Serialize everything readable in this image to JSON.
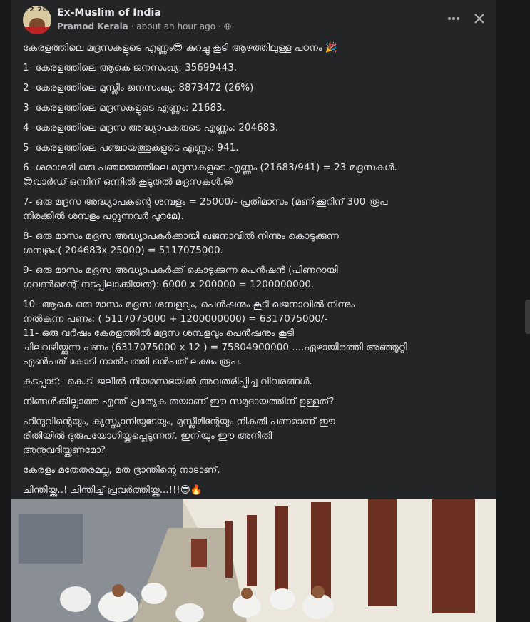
{
  "post": {
    "group_name": "Ex-Muslim of India",
    "author": "Pramod Kerala",
    "time": "about an hour ago",
    "separator": "·",
    "avatar_text": "22 20",
    "paragraphs": [
      "കേരളത്തിലെ മദ്രസകളുടെ എണ്ണം😎 കുറച്ചു കൂടി ആഴത്തിലുള്ള പഠനം 🎉",
      "1- കേരളത്തിലെ ആകെ ജനസംഖ്യ: 35699443.",
      "2- കേരളത്തിലെ മുസ്ലീം ജനസംഖ്യ: 8873472 (26%)",
      "3- കേരളത്തിലെ മദ്രസകളുടെ എണ്ണം: 21683.",
      "4- കേരളത്തിലെ മദ്രസ അദ്ധ്യാപകരുടെ എണ്ണം: 204683.",
      "5- കേരളത്തിലെ പഞ്ചായത്തുകളുടെ എണ്ണം: 941.",
      "6- ശരാശരി ഒരു പഞ്ചായത്തിലെ മദ്രസകളുടെ എണ്ണം (21683/941) = 23 മദ്രസകൾ.\n😎വാർഡ് ഒന്നിന് ഒന്നിൽ കൂടുതൽ മദ്രസകൾ.😀",
      "7- ഒരു മദ്രസ അദ്ധ്യാപകന്റെ ശമ്പളം = 25000/- പ്രതിമാസം (മണിക്കൂറിന് 300 രൂപ\nനിരക്കിൽ ശമ്പളം പറ്റുന്നവർ പുറമേ).",
      "8- ഒരു മാസം മദ്രസ അദ്ധ്യാപകർക്കായി ഖജനാവിൽ നിന്നും കൊടുക്കുന്ന\nശമ്പളം:( 204683x 25000) = 5117075000.",
      "9- ഒരു മാസം മദ്രസ അദ്ധ്യാപകർക്ക് കൊടുക്കുന്ന പെൻഷൻ (പിണറായി\nഗവൺമെന്റ് നടപ്പിലാക്കിയത്): 6000 x 200000 = 1200000000.",
      "10- ആകെ ഒരു മാസം മദ്രസ ശമ്പളവും, പെൻഷനും കൂടി ഖജനാവിൽ നിന്നും\nനൽകുന്ന പണം: ( 5117075000 + 1200000000) = 6317075000/-",
      "11- ഒരു വർഷം കേരളത്തിൽ മദ്രസ ശമ്പളവും പെൻഷനും കൂടി\nചിലവഴിയ്ക്കുന്ന പണം (6317075000 x 12 ) = 75804900000 ....ഏഴായിരത്തി അഞ്ഞൂറ്റി\nഎൺപത് കോടി നാൽപത്തി ഒൻപത് ലക്ഷം രൂപ.",
      "കടപ്പാട്:- കെ.ടി ജലീൽ നിയമസഭയിൽ അവതരിപ്പിച്ച വിവരങ്ങൾ.",
      "നിങ്ങൾക്കില്ലാത്ത എന്ത് പ്രത്യേക തയാണ് ഈ സമുദായത്തിന് ഉള്ളത്?",
      "ഹിന്ദുവിന്റെയും, ക്യസ്ത്യാനിയുടേയും, മുസ്ലീമിന്റേയും നികുതി പണമാണ് ഈ\nരീതിയിൽ ദുരുപയോഗിയ്ക്കപ്പെടുന്നത്. ഇനിയും ഈ അനീതി\nഅനുവദിയ്ക്കണമോ?",
      "കേരളം മതേതരമല്ല, മത ഭ്രാന്തിന്റെ നാടാണ്.",
      "ചിന്തിയ്ക്കു..!  ചിന്തിച്ച് പ്രവർത്തിയ്ക്കു...!!!😎🔥"
    ]
  },
  "icons": {
    "more": "more-options-icon",
    "close": "close-icon",
    "globe": "globe-icon"
  },
  "colors": {
    "page_bg": "#18191a",
    "card_bg": "#242526",
    "text": "#e4e6eb",
    "meta": "#b0b3b8"
  }
}
